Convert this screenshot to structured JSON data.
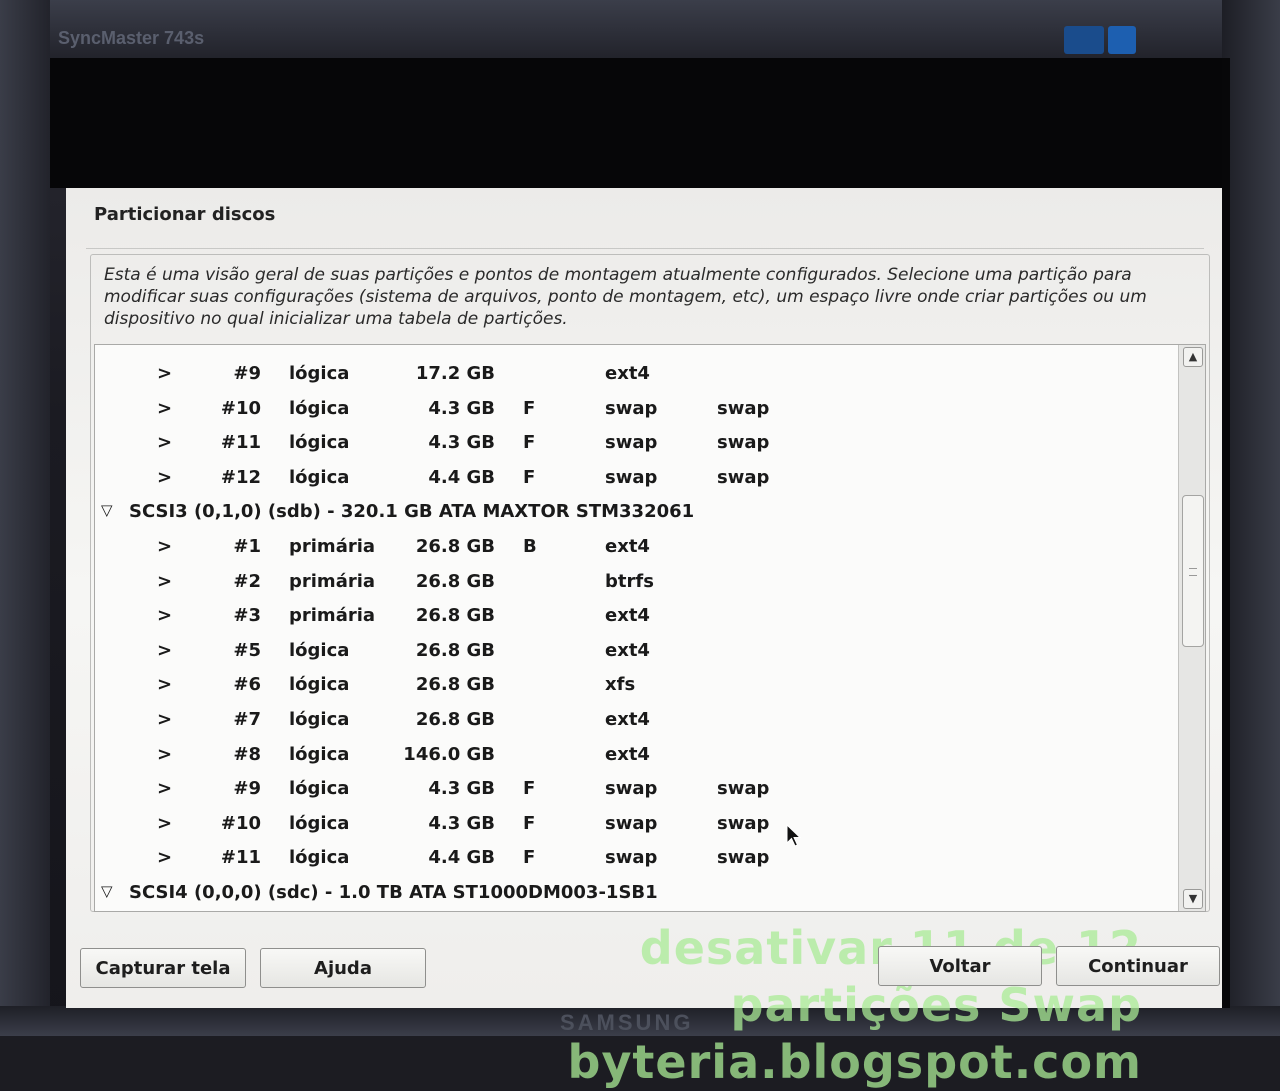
{
  "monitor": {
    "model": "SyncMaster 743s",
    "brand": "SAMSUNG"
  },
  "dialog": {
    "title": "Particionar discos",
    "description": "Esta é uma visão geral de suas partições e pontos de montagem atualmente configurados. Selecione uma partição para modificar suas configurações (sistema de arquivos, ponto de montagem, etc), um espaço livre onde criar partições ou um dispositivo no qual inicializar uma tabela de partições."
  },
  "tree": {
    "rows": [
      {
        "kind": "part",
        "expander": ">",
        "num": "#9",
        "type": "lógica",
        "size": "17.2 GB",
        "flag": "",
        "fs": "ext4",
        "mount": ""
      },
      {
        "kind": "part",
        "expander": ">",
        "num": "#10",
        "type": "lógica",
        "size": "4.3 GB",
        "flag": "F",
        "fs": "swap",
        "mount": "swap"
      },
      {
        "kind": "part",
        "expander": ">",
        "num": "#11",
        "type": "lógica",
        "size": "4.3 GB",
        "flag": "F",
        "fs": "swap",
        "mount": "swap"
      },
      {
        "kind": "part",
        "expander": ">",
        "num": "#12",
        "type": "lógica",
        "size": "4.4 GB",
        "flag": "F",
        "fs": "swap",
        "mount": "swap"
      },
      {
        "kind": "disk",
        "expander": "▽",
        "label": "SCSI3 (0,1,0) (sdb) - 320.1 GB ATA MAXTOR STM332061"
      },
      {
        "kind": "part",
        "expander": ">",
        "num": "#1",
        "type": "primária",
        "size": "26.8 GB",
        "flag": "B",
        "fs": "ext4",
        "mount": ""
      },
      {
        "kind": "part",
        "expander": ">",
        "num": "#2",
        "type": "primária",
        "size": "26.8 GB",
        "flag": "",
        "fs": "btrfs",
        "mount": ""
      },
      {
        "kind": "part",
        "expander": ">",
        "num": "#3",
        "type": "primária",
        "size": "26.8 GB",
        "flag": "",
        "fs": "ext4",
        "mount": ""
      },
      {
        "kind": "part",
        "expander": ">",
        "num": "#5",
        "type": "lógica",
        "size": "26.8 GB",
        "flag": "",
        "fs": "ext4",
        "mount": ""
      },
      {
        "kind": "part",
        "expander": ">",
        "num": "#6",
        "type": "lógica",
        "size": "26.8 GB",
        "flag": "",
        "fs": "xfs",
        "mount": ""
      },
      {
        "kind": "part",
        "expander": ">",
        "num": "#7",
        "type": "lógica",
        "size": "26.8 GB",
        "flag": "",
        "fs": "ext4",
        "mount": ""
      },
      {
        "kind": "part",
        "expander": ">",
        "num": "#8",
        "type": "lógica",
        "size": "146.0 GB",
        "flag": "",
        "fs": "ext4",
        "mount": ""
      },
      {
        "kind": "part",
        "expander": ">",
        "num": "#9",
        "type": "lógica",
        "size": "4.3 GB",
        "flag": "F",
        "fs": "swap",
        "mount": "swap"
      },
      {
        "kind": "part",
        "expander": ">",
        "num": "#10",
        "type": "lógica",
        "size": "4.3 GB",
        "flag": "F",
        "fs": "swap",
        "mount": "swap"
      },
      {
        "kind": "part",
        "expander": ">",
        "num": "#11",
        "type": "lógica",
        "size": "4.4 GB",
        "flag": "F",
        "fs": "swap",
        "mount": "swap"
      },
      {
        "kind": "disk",
        "expander": "▽",
        "label": "SCSI4 (0,0,0) (sdc) - 1.0 TB ATA ST1000DM003-1SB1"
      }
    ]
  },
  "watermark": {
    "line1": "desativar 11 de 12",
    "line2": "partições Swap",
    "line3": "byteria.blogspot.com"
  },
  "buttons": {
    "capture": "Capturar tela",
    "help": "Ajuda",
    "back": "Voltar",
    "continue": "Continuar"
  }
}
